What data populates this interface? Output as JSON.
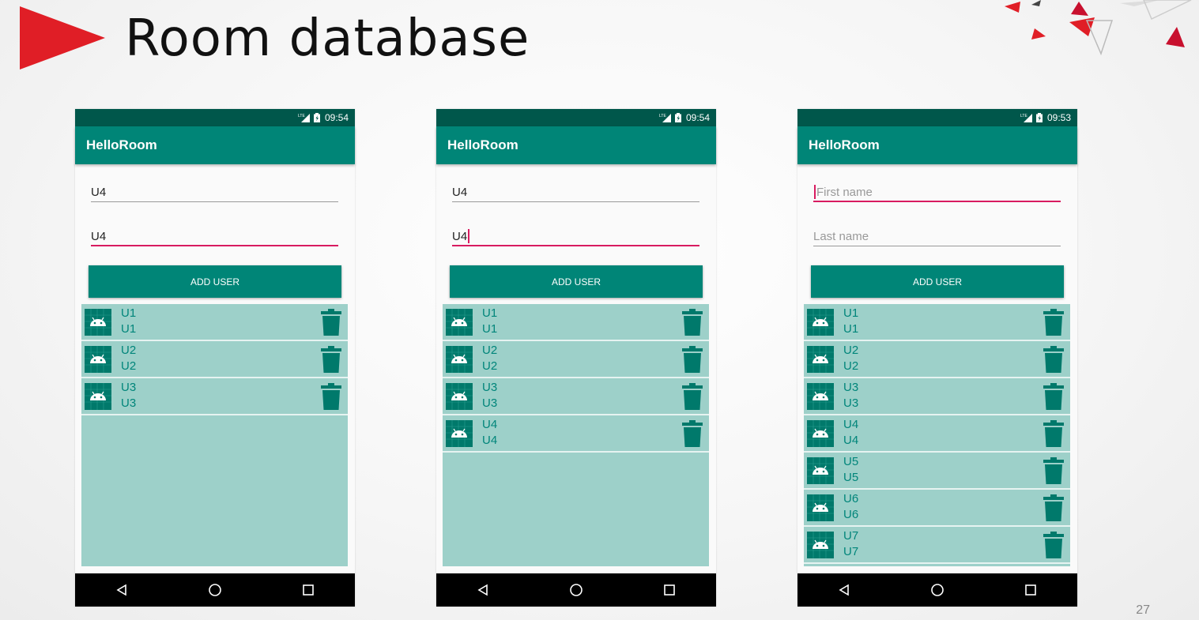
{
  "slide": {
    "title": "Room database",
    "number": "27",
    "accent_color": "#e01e26"
  },
  "theme": {
    "primary": "#008577",
    "primary_dark": "#00574b",
    "accent": "#d81b60",
    "list_bg": "#9dd0c9",
    "item_text": "#00857a"
  },
  "phones": [
    {
      "time": "09:54",
      "app_title": "HelloRoom",
      "first_name": {
        "value": "U4",
        "placeholder": "First name",
        "focused": false,
        "cursor": false
      },
      "last_name": {
        "value": "U4",
        "placeholder": "Last name",
        "focused": true,
        "cursor": false
      },
      "button_label": "ADD USER",
      "users": [
        {
          "first": "U1",
          "last": "U1"
        },
        {
          "first": "U2",
          "last": "U2"
        },
        {
          "first": "U3",
          "last": "U3"
        }
      ]
    },
    {
      "time": "09:54",
      "app_title": "HelloRoom",
      "first_name": {
        "value": "U4",
        "placeholder": "First name",
        "focused": false,
        "cursor": false
      },
      "last_name": {
        "value": "U4",
        "placeholder": "Last name",
        "focused": true,
        "cursor": true
      },
      "button_label": "ADD USER",
      "users": [
        {
          "first": "U1",
          "last": "U1"
        },
        {
          "first": "U2",
          "last": "U2"
        },
        {
          "first": "U3",
          "last": "U3"
        },
        {
          "first": "U4",
          "last": "U4"
        }
      ]
    },
    {
      "time": "09:53",
      "app_title": "HelloRoom",
      "first_name": {
        "value": "",
        "placeholder": "First name",
        "focused": true,
        "cursor": true
      },
      "last_name": {
        "value": "",
        "placeholder": "Last name",
        "focused": false,
        "cursor": false
      },
      "button_label": "ADD USER",
      "users": [
        {
          "first": "U1",
          "last": "U1"
        },
        {
          "first": "U2",
          "last": "U2"
        },
        {
          "first": "U3",
          "last": "U3"
        },
        {
          "first": "U4",
          "last": "U4"
        },
        {
          "first": "U5",
          "last": "U5"
        },
        {
          "first": "U6",
          "last": "U6"
        },
        {
          "first": "U7",
          "last": "U7"
        }
      ]
    }
  ]
}
